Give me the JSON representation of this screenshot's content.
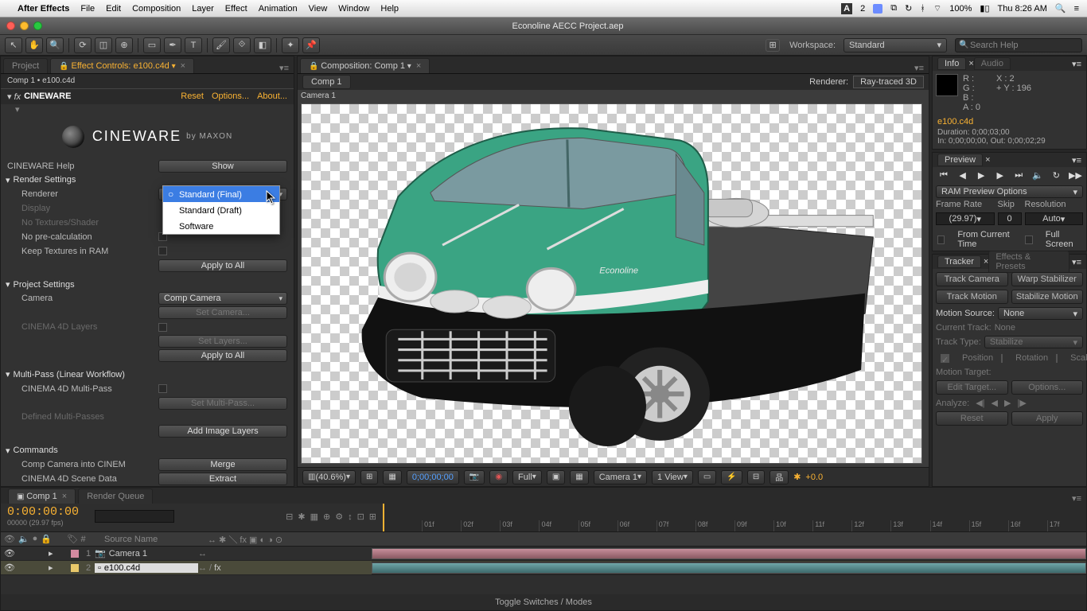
{
  "mac_menu": {
    "app": "After Effects",
    "items": [
      "File",
      "Edit",
      "Composition",
      "Layer",
      "Effect",
      "Animation",
      "View",
      "Window",
      "Help"
    ],
    "clock": "Thu 8:26 AM",
    "battery": "100%"
  },
  "window_title": "Econoline AECC Project.aep",
  "workspace": {
    "label": "Workspace:",
    "value": "Standard"
  },
  "search_placeholder": "Search Help",
  "left": {
    "tabs": {
      "project": "Project",
      "effect_controls": "Effect Controls: e100.c4d"
    },
    "breadcrumb": "Comp 1 • e100.c4d",
    "effect_name": "CINEWARE",
    "links": {
      "reset": "Reset",
      "options": "Options...",
      "about": "About..."
    },
    "brand": "CINEWARE",
    "brand_by": "by MAXON",
    "help_label": "CINEWARE Help",
    "help_btn": "Show",
    "render_settings": "Render Settings",
    "renderer_label": "Renderer",
    "renderer_value": "Standard (Final)",
    "display": "Display",
    "no_tex": "No Textures/Shader",
    "no_precalc": "No pre-calculation",
    "keep_tex": "Keep Textures in RAM",
    "apply_all": "Apply to All",
    "project_settings": "Project Settings",
    "camera_label": "Camera",
    "camera_value": "Comp Camera",
    "set_camera": "Set Camera...",
    "c4d_layers": "CINEMA 4D Layers",
    "set_layers": "Set Layers...",
    "apply_all2": "Apply to All",
    "multipass": "Multi-Pass (Linear Workflow)",
    "c4d_mp": "CINEMA 4D Multi-Pass",
    "set_mp": "Set Multi-Pass...",
    "defined_mp": "Defined Multi-Passes",
    "add_img": "Add Image Layers",
    "commands": "Commands",
    "comp_cam": "Comp Camera into CINEM",
    "merge": "Merge",
    "scene_data": "CINEMA 4D Scene Data",
    "extract": "Extract"
  },
  "dropdown_options": [
    "Standard (Final)",
    "Standard (Draft)",
    "Software"
  ],
  "center": {
    "panel_title": "Composition: Comp 1",
    "chip": "Comp 1",
    "renderer_label": "Renderer:",
    "renderer_value": "Ray-traced 3D",
    "camera": "Camera 1",
    "footer": {
      "zoom": "(40.6%)",
      "time": "0;00;00;00",
      "res": "Full",
      "cam": "Camera 1",
      "views": "1 View",
      "exp": "+0.0"
    }
  },
  "right": {
    "info": "Info",
    "audio": "Audio",
    "rgba": {
      "R": "R :",
      "G": "G :",
      "B": "B :",
      "A": "A : 0"
    },
    "xy": {
      "X": "X : 2",
      "Y": "Y : 196"
    },
    "layer_name": "e100.c4d",
    "duration": "Duration: 0;00;03;00",
    "inout": "In: 0;00;00;00, Out: 0;00;02;29",
    "preview": "Preview",
    "ram": "RAM Preview Options",
    "frame_rate": "Frame Rate",
    "skip": "Skip",
    "resolution": "Resolution",
    "fr_val": "(29.97)",
    "skip_val": "0",
    "res_val": "Auto",
    "from_current": "From Current Time",
    "full_screen": "Full Screen",
    "tracker": "Tracker",
    "ep": "Effects & Presets",
    "track_cam": "Track Camera",
    "warp": "Warp Stabilizer",
    "track_mot": "Track Motion",
    "stab": "Stabilize Motion",
    "msrc": "Motion Source:",
    "msrc_val": "None",
    "ctrack": "Current Track:",
    "ctrack_val": "None",
    "ttype": "Track Type:",
    "ttype_val": "Stabilize",
    "pos": "Position",
    "rot": "Rotation",
    "scale": "Scale",
    "mtgt": "Motion Target:",
    "edit_tgt": "Edit Target...",
    "options": "Options...",
    "analyze": "Analyze:",
    "reset": "Reset",
    "apply": "Apply"
  },
  "timeline": {
    "tabs": {
      "comp": "Comp 1",
      "rq": "Render Queue"
    },
    "timecode": "0:00:00:00",
    "fps": "00000 (29.97 fps)",
    "col_source": "Source Name",
    "ticks": [
      "01f",
      "02f",
      "03f",
      "04f",
      "05f",
      "06f",
      "07f",
      "08f",
      "09f",
      "10f",
      "11f",
      "12f",
      "13f",
      "14f",
      "15f",
      "16f",
      "17f"
    ],
    "layers": [
      {
        "num": "1",
        "name": "Camera 1",
        "sel": false,
        "color": "#d48aa0"
      },
      {
        "num": "2",
        "name": "e100.c4d",
        "sel": true,
        "color": "#e8c86a"
      }
    ],
    "footer": "Toggle Switches / Modes"
  }
}
